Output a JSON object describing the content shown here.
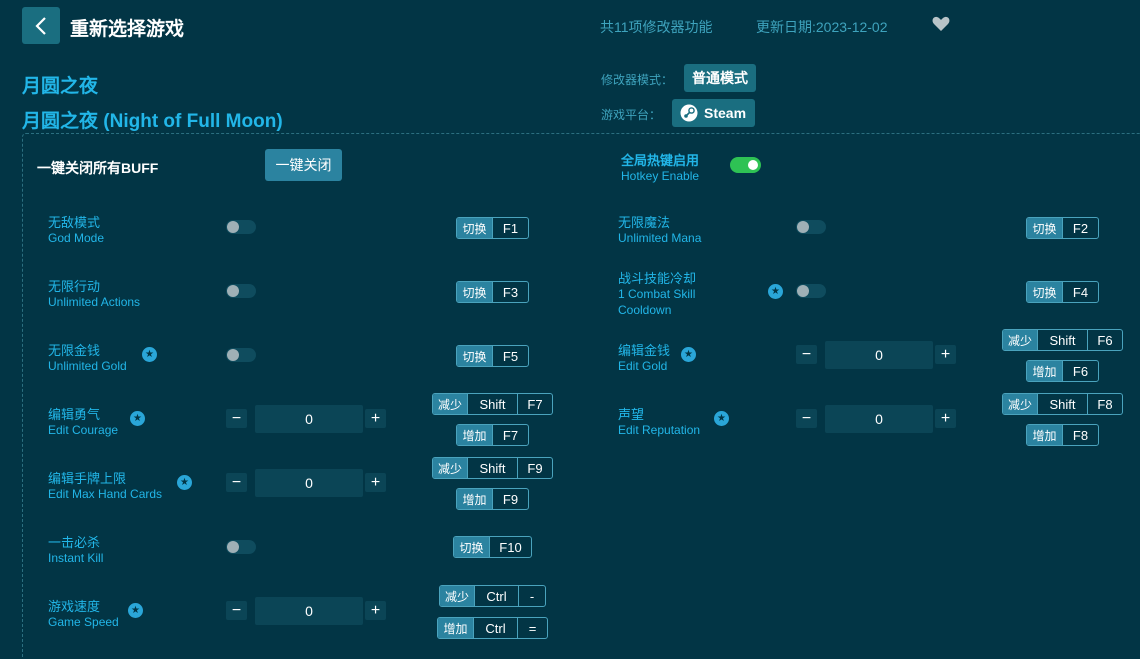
{
  "header": {
    "title": "重新选择游戏",
    "feature_count": "共11项修改器功能",
    "update_date": "更新日期:2023-12-02"
  },
  "game": {
    "title_cn": "月圆之夜",
    "title_full": "月圆之夜 (Night of Full Moon)"
  },
  "meta": {
    "mode_label": "修改器模式：",
    "mode_value": "普通模式",
    "platform_label": "游戏平台：",
    "platform_value": "Steam"
  },
  "controls": {
    "all_buff_label": "一键关闭所有BUFF",
    "all_buff_button": "一键关闭",
    "hotkey_zh": "全局热键启用",
    "hotkey_en": "Hotkey Enable",
    "hotkey_enabled": true
  },
  "key_labels": {
    "toggle": "切换",
    "decrease": "减少",
    "increase": "增加"
  },
  "cheats": {
    "god_mode": {
      "zh": "无敌模式",
      "en": "God Mode",
      "key": "F1",
      "on": false
    },
    "unlimited_mana": {
      "zh": "无限魔法",
      "en": "Unlimited Mana",
      "key": "F2",
      "on": false
    },
    "unlimited_actions": {
      "zh": "无限行动",
      "en": "Unlimited Actions",
      "key": "F3",
      "on": false
    },
    "combat_cd": {
      "zh": "战斗技能冷却",
      "en1": "1 Combat Skill",
      "en2": "Cooldown",
      "key": "F4",
      "on": false
    },
    "unlimited_gold": {
      "zh": "无限金钱",
      "en": "Unlimited Gold",
      "key": "F5",
      "on": false
    },
    "edit_gold": {
      "zh": "编辑金钱",
      "en": "Edit Gold",
      "value": "0",
      "dec_mod": "Shift",
      "dec_key": "F6",
      "inc_key": "F6"
    },
    "edit_courage": {
      "zh": "编辑勇气",
      "en": "Edit Courage",
      "value": "0",
      "dec_mod": "Shift",
      "dec_key": "F7",
      "inc_key": "F7"
    },
    "edit_reputation": {
      "zh": "声望",
      "en": "Edit Reputation",
      "value": "0",
      "dec_mod": "Shift",
      "dec_key": "F8",
      "inc_key": "F8"
    },
    "edit_hand": {
      "zh": "编辑手牌上限",
      "en": "Edit Max Hand Cards",
      "value": "0",
      "dec_mod": "Shift",
      "dec_key": "F9",
      "inc_key": "F9"
    },
    "instant_kill": {
      "zh": "一击必杀",
      "en": "Instant Kill",
      "key": "F10",
      "on": false
    },
    "game_speed": {
      "zh": "游戏速度",
      "en": "Game Speed",
      "value": "0",
      "dec_mod": "Ctrl",
      "dec_key": "-",
      "inc_mod": "Ctrl",
      "inc_key": "="
    }
  },
  "stepper": {
    "minus": "−",
    "plus": "+"
  },
  "colors": {
    "background": "#023545",
    "accent": "#22b6e8",
    "button": "#2b83a0",
    "toggle_on": "#2ec254"
  }
}
